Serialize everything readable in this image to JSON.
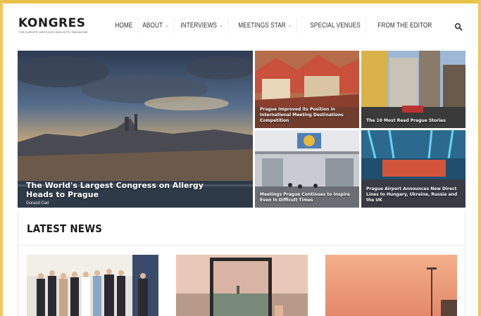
{
  "site": {
    "logo_title": "KONGRES",
    "logo_subtitle": "THE EUROPE MEETINGS INDUSTRY MAGAZINE"
  },
  "nav": {
    "items": [
      {
        "label": "HOME",
        "has_dropdown": false
      },
      {
        "label": "ABOUT",
        "has_dropdown": true
      },
      {
        "label": "INTERVIEWS",
        "has_dropdown": true
      },
      {
        "label": "MEETINGS STAR",
        "has_dropdown": true
      },
      {
        "label": "SPECIAL VENUES",
        "has_dropdown": false
      },
      {
        "label": "FROM THE EDITOR",
        "has_dropdown": false
      }
    ],
    "chevron": "⌄",
    "search_icon": "search-icon"
  },
  "hero": {
    "main": {
      "title": "The World's Largest Congress on Allergy Heads to Prague",
      "author": "Gorazd Cad"
    },
    "tiles": [
      {
        "title": "Prague Improved its Position in International Meeting Destinations Competition"
      },
      {
        "title": "The 10 Most Read Prague Stories"
      },
      {
        "title": "Meetings Prague Continues to Inspire Even in Difficult Times"
      },
      {
        "title": "Prague Airport Announces New Direct Lines to Hungary, Ukraine, Russia and the UK"
      }
    ]
  },
  "latest": {
    "heading": "LATEST NEWS"
  },
  "colors": {
    "frame": "#e9c24a",
    "text": "#222222",
    "rule": "#ececec"
  }
}
